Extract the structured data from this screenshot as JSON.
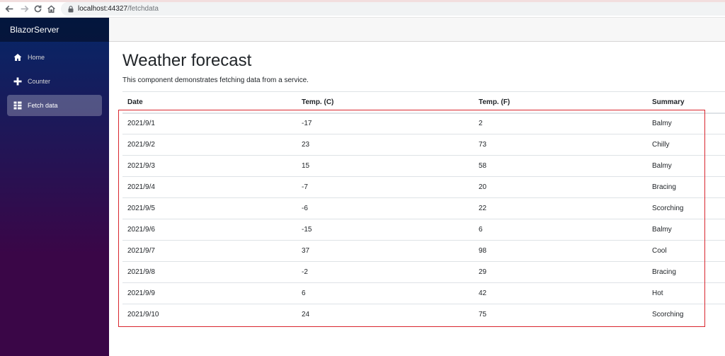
{
  "browser": {
    "url_host": "localhost:44327",
    "url_path": "/fetchdata",
    "icons": [
      "back-icon",
      "forward-icon",
      "reload-icon",
      "home-icon",
      "lock-icon"
    ]
  },
  "sidebar": {
    "brand": "BlazorServer",
    "items": [
      {
        "label": "Home",
        "icon": "home-icon",
        "active": false
      },
      {
        "label": "Counter",
        "icon": "plus-icon",
        "active": false
      },
      {
        "label": "Fetch data",
        "icon": "list-icon",
        "active": true
      }
    ]
  },
  "main": {
    "title": "Weather forecast",
    "description": "This component demonstrates fetching data from a service.",
    "table": {
      "headers": [
        "Date",
        "Temp. (C)",
        "Temp. (F)",
        "Summary"
      ],
      "rows": [
        [
          "2021/9/1",
          "-17",
          "2",
          "Balmy"
        ],
        [
          "2021/9/2",
          "23",
          "73",
          "Chilly"
        ],
        [
          "2021/9/3",
          "15",
          "58",
          "Balmy"
        ],
        [
          "2021/9/4",
          "-7",
          "20",
          "Bracing"
        ],
        [
          "2021/9/5",
          "-6",
          "22",
          "Scorching"
        ],
        [
          "2021/9/6",
          "-15",
          "6",
          "Balmy"
        ],
        [
          "2021/9/7",
          "37",
          "98",
          "Cool"
        ],
        [
          "2021/9/8",
          "-2",
          "29",
          "Bracing"
        ],
        [
          "2021/9/9",
          "6",
          "42",
          "Hot"
        ],
        [
          "2021/9/10",
          "24",
          "75",
          "Scorching"
        ]
      ]
    }
  },
  "colors": {
    "sidebar_top": "#052767",
    "sidebar_bottom": "#3a0647",
    "highlight": "#d9262e"
  }
}
